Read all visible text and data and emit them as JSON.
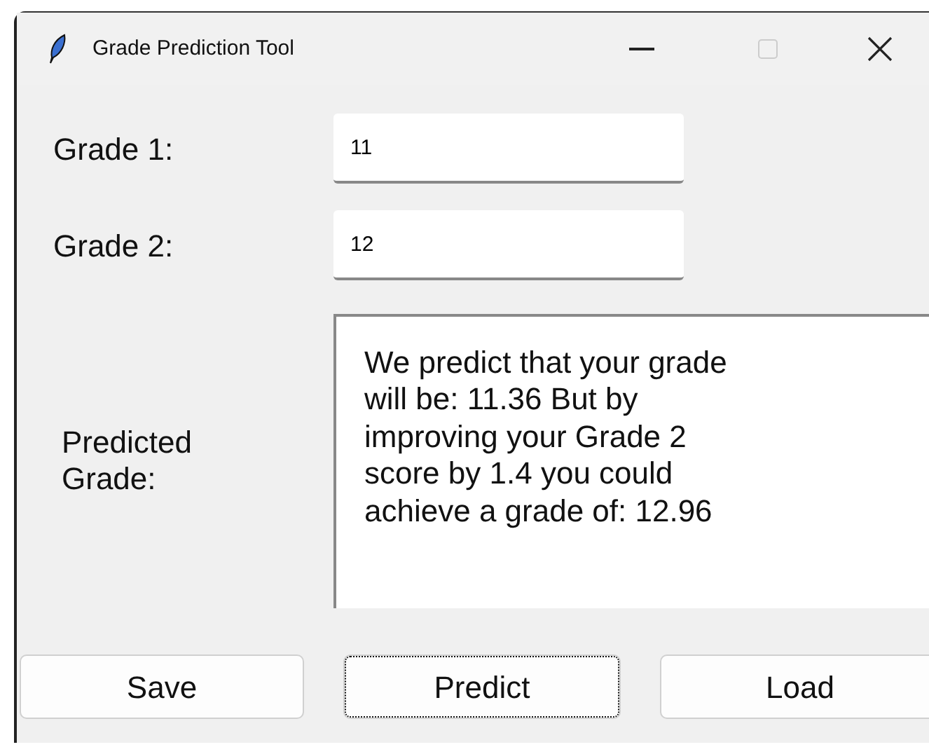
{
  "window": {
    "title": "Grade Prediction Tool"
  },
  "fields": [
    {
      "label": "Grade 1:",
      "value": "11"
    },
    {
      "label": "Grade 2:",
      "value": "12"
    }
  ],
  "prediction": {
    "label": "Predicted\nGrade:",
    "text": "We predict that your grade\nwill be: 11.36 But by\nimproving your Grade 2\nscore by 1.4 you could\nachieve a grade of: 12.96"
  },
  "buttons": [
    {
      "label": "Save",
      "focused": false
    },
    {
      "label": "Predict",
      "focused": true
    },
    {
      "label": "Load",
      "focused": false
    }
  ]
}
